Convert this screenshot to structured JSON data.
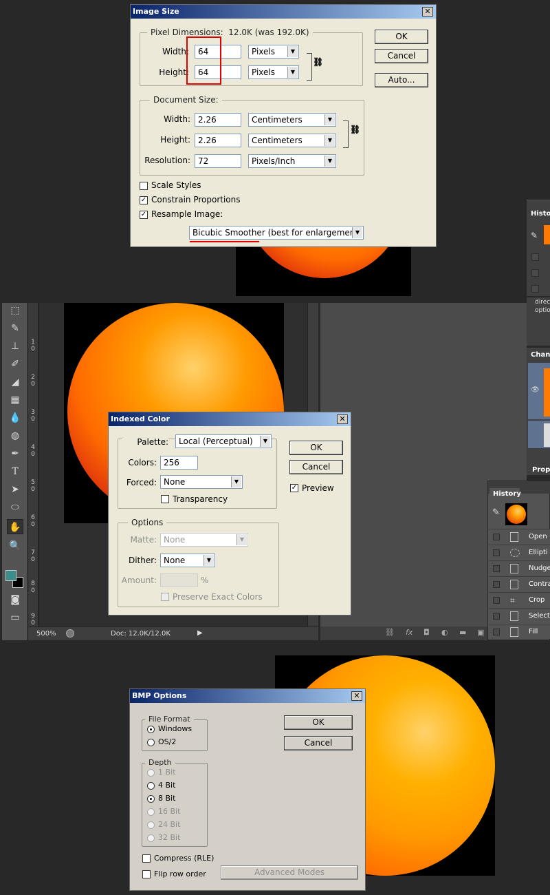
{
  "colors": {
    "titlebar_start": "#0a246a",
    "titlebar_end": "#a6caf0",
    "dialog_bg": "#ece9d8",
    "app_bg": "#282828",
    "highlight_red": "#e00000",
    "sphere_orange": "#ff9a00",
    "sphere_red": "#d42410"
  },
  "image_size": {
    "title": "Image Size",
    "pixel_dimensions": {
      "label": "Pixel Dimensions:",
      "size": "12.0K (was 192.0K)"
    },
    "width_label": "Width:",
    "width_value": "64",
    "width_unit": "Pixels",
    "height_label": "Height:",
    "height_value": "64",
    "height_unit": "Pixels",
    "document_size_label": "Document Size:",
    "doc_width_label": "Width:",
    "doc_width_value": "2.26",
    "doc_width_unit": "Centimeters",
    "doc_height_label": "Height:",
    "doc_height_value": "2.26",
    "doc_height_unit": "Centimeters",
    "resolution_label": "Resolution:",
    "resolution_value": "72",
    "resolution_unit": "Pixels/Inch",
    "scale_styles": "Scale Styles",
    "scale_styles_checked": false,
    "constrain": "Constrain Proportions",
    "constrain_checked": true,
    "resample": "Resample Image:",
    "resample_checked": true,
    "resample_method": "Bicubic Smoother (best for enlargement)",
    "ok": "OK",
    "cancel": "Cancel",
    "auto": "Auto..."
  },
  "indexed_color": {
    "title": "Indexed Color",
    "palette_label": "Palette:",
    "palette_value": "Local (Perceptual)",
    "colors_label": "Colors:",
    "colors_value": "256",
    "forced_label": "Forced:",
    "forced_value": "None",
    "transparency": "Transparency",
    "transparency_checked": false,
    "options_label": "Options",
    "matte_label": "Matte:",
    "matte_value": "None",
    "dither_label": "Dither:",
    "dither_value": "None",
    "amount_label": "Amount:",
    "amount_unit": "%",
    "preserve": "Preserve Exact Colors",
    "preserve_checked": false,
    "ok": "OK",
    "cancel": "Cancel",
    "preview": "Preview",
    "preview_checked": true
  },
  "bmp_options": {
    "title": "BMP Options",
    "file_format_label": "File Format",
    "formats": [
      {
        "label": "Windows",
        "selected": true
      },
      {
        "label": "OS/2",
        "selected": false
      }
    ],
    "depth_label": "Depth",
    "depths": [
      {
        "label": "1 Bit",
        "selected": false,
        "enabled": false
      },
      {
        "label": "4 Bit",
        "selected": false,
        "enabled": true
      },
      {
        "label": "8 Bit",
        "selected": true,
        "enabled": true
      },
      {
        "label": "16 Bit",
        "selected": false,
        "enabled": false
      },
      {
        "label": "24 Bit",
        "selected": false,
        "enabled": false
      },
      {
        "label": "32 Bit",
        "selected": false,
        "enabled": false
      }
    ],
    "compress": "Compress (RLE)",
    "compress_checked": false,
    "flip": "Flip row order",
    "flip_checked": false,
    "advanced": "Advanced Modes",
    "ok": "OK",
    "cancel": "Cancel"
  },
  "photoshop": {
    "ruler_numbers": [
      "1\n0",
      "2\n0",
      "3\n0",
      "4\n0",
      "5\n0",
      "6\n0",
      "7\n0",
      "8\n0",
      "9\n0"
    ],
    "zoom": "500%",
    "doc_info": "Doc: 12.0K/12.0K",
    "channels_tab": "Chann",
    "properties_tab": "Prope",
    "history_tab_top": "Histo",
    "direct_text_1": "direc",
    "direct_text_2": "optio",
    "history_tab": "History",
    "history_items": [
      "Open",
      "Ellipti",
      "Nudge",
      "Contra",
      "Crop",
      "Select",
      "Fill"
    ],
    "history_icons": [
      "doc-icon",
      "ellipse-select-icon",
      "doc-icon",
      "doc-icon",
      "crop-icon",
      "doc-icon",
      "fill-icon"
    ],
    "tools": [
      "marquee-icon",
      "brush-icon",
      "stamp-icon",
      "history-brush-icon",
      "eraser-icon",
      "gradient-icon",
      "blur-icon",
      "dodge-icon",
      "pen-icon",
      "type-icon",
      "path-select-icon",
      "ellipse-icon",
      "hand-icon",
      "zoom-icon"
    ]
  }
}
